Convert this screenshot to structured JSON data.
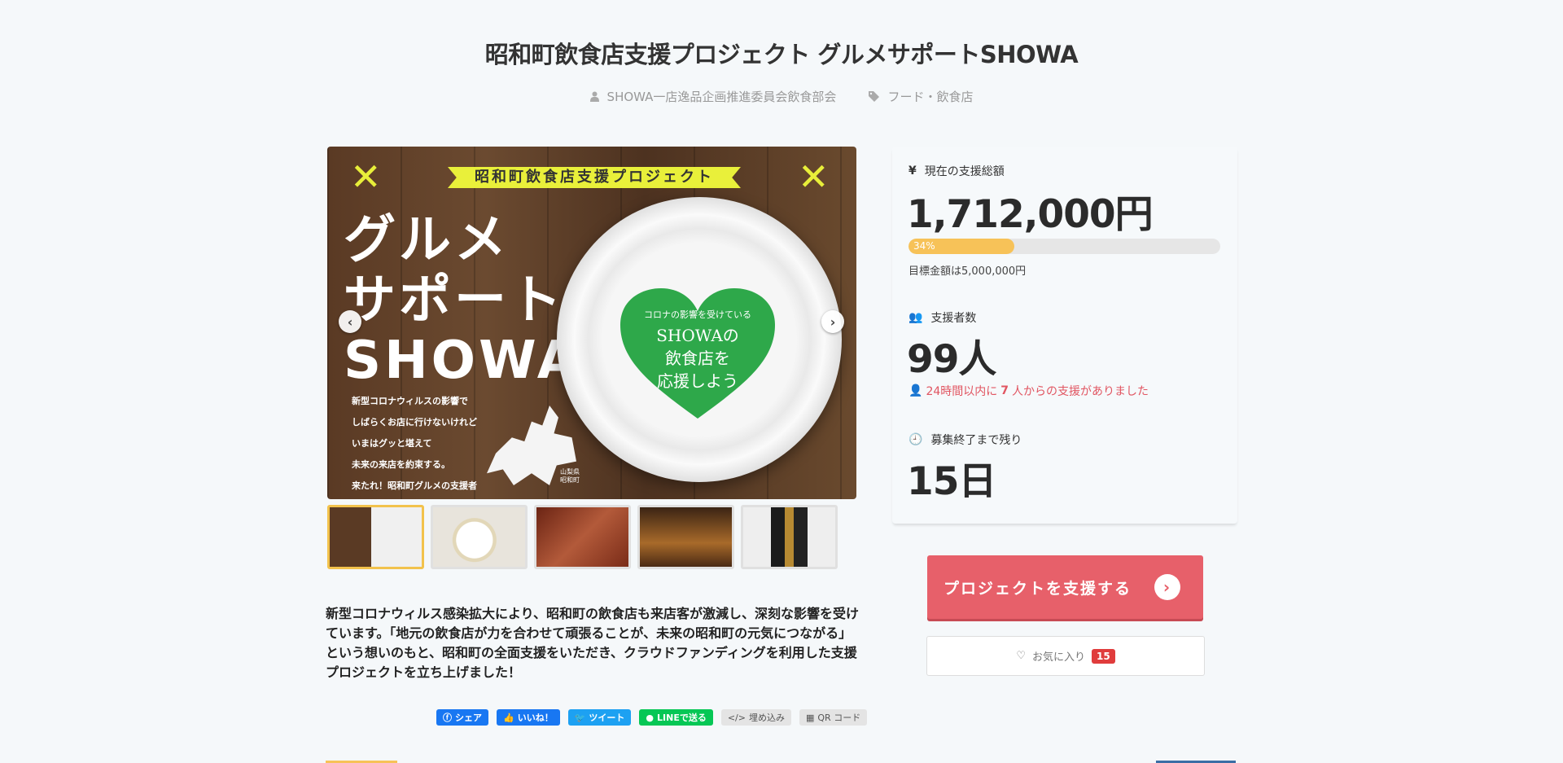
{
  "project": {
    "title": "昭和町飲食店支援プロジェクト グルメサポートSHOWA",
    "owner": "SHOWA一店逸品企画推進委員会飲食部会",
    "category": "フード・飲食店"
  },
  "hero_image": {
    "banner": "昭和町飲食店支援プロジェクト",
    "headline": "グルメ\nサポート\nSHOWA",
    "body": "新型コロナウィルスの影響で\nしばらくお店に行けないけれど\nいまはグッと堪えて\n未来の来店を約束する。\n来たれ！昭和町グルメの支援者",
    "heart_top": "コロナの影響を受けている",
    "heart_main": "SHOWAの\n飲食店を\n応援しよう",
    "map_label": "山梨県\n昭和町",
    "prev_icon": "chevron-left-icon",
    "next_icon": "chevron-right-icon"
  },
  "thumbnails": [
    {
      "alt": "グルメサポートSHOWA",
      "active": true
    },
    {
      "alt": "料理",
      "active": false
    },
    {
      "alt": "肉",
      "active": false
    },
    {
      "alt": "店内",
      "active": false
    },
    {
      "alt": "酒",
      "active": false
    }
  ],
  "description": "新型コロナウィルス感染拡大により、昭和町の飲食店も来店客が激減し、深刻な影響を受けています。「地元の飲食店が力を合わせて頑張ることが、未来の昭和町の元気につながる」という想いのもと、昭和町の全面支援をいただき、クラウドファンディングを利用した支援プロジェクトを立ち上げました！",
  "share": {
    "facebook": "シェア",
    "like": "いいね！",
    "tweet": "ツイート",
    "line": "LINEで送る",
    "embed": "埋め込み",
    "qr": "QR コード"
  },
  "stats": {
    "amount_label": "現在の支援総額",
    "amount": "1,712,000円",
    "progress_percent": 34,
    "progress_label": "34%",
    "goal": "目標金額は5,000,000円",
    "supporters_label": "支援者数",
    "supporters": "99人",
    "recent_prefix": "24時間以内に",
    "recent_count": "7",
    "recent_suffix": "人からの支援がありました",
    "remaining_label": "募集終了まで残り",
    "remaining": "15日"
  },
  "actions": {
    "support_label": "プロジェクトを支援する",
    "favorite_label": "お気に入り",
    "favorite_count": "15"
  },
  "colors": {
    "accent": "#e7606a",
    "progress": "#f7c258",
    "alert": "#e15561",
    "background": "#f5f8fa"
  }
}
